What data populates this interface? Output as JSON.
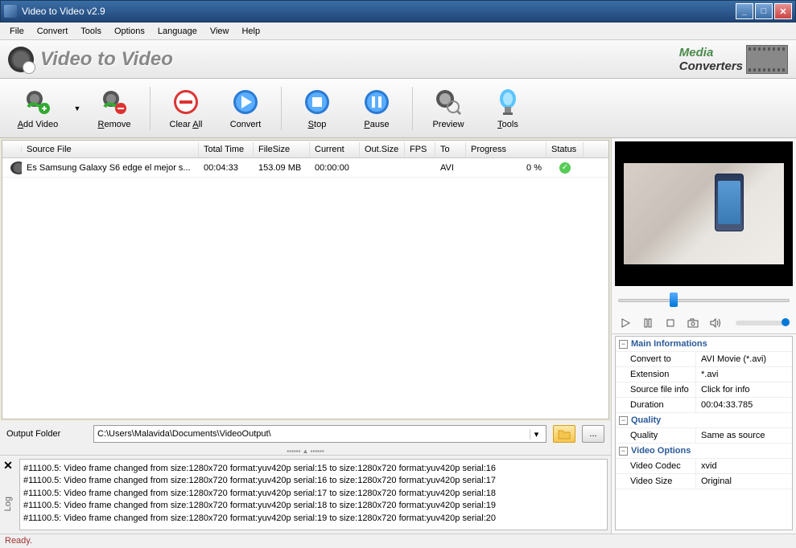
{
  "window": {
    "title": "Video to Video v2.9"
  },
  "menu": [
    "File",
    "Convert",
    "Tools",
    "Options",
    "Language",
    "View",
    "Help"
  ],
  "banner": {
    "title": "Video to Video",
    "brand1": "Media",
    "brand2": "Converters"
  },
  "toolbar": {
    "add": "Add Video",
    "remove": "Remove",
    "clear": "Clear All",
    "convert": "Convert",
    "stop": "Stop",
    "pause": "Pause",
    "preview": "Preview",
    "tools": "Tools"
  },
  "columns": {
    "source": "Source File",
    "time": "Total Time",
    "size": "FileSize",
    "current": "Current",
    "outsize": "Out.Size",
    "fps": "FPS",
    "to": "To",
    "progress": "Progress",
    "status": "Status"
  },
  "rows": [
    {
      "source": "Es Samsung Galaxy S6 edge el mejor s...",
      "time": "00:04:33",
      "size": "153.09 MB",
      "current": "00:00:00",
      "outsize": "",
      "fps": "",
      "to": "AVI",
      "progress": "0 %",
      "status": "ok"
    }
  ],
  "output": {
    "label": "Output Folder",
    "path": "C:\\Users\\Malavida\\Documents\\VideoOutput\\"
  },
  "log": {
    "label": "Log",
    "lines": [
      "#11100.5: Video frame changed from size:1280x720 format:yuv420p serial:15 to size:1280x720 format:yuv420p serial:16",
      "#11100.5: Video frame changed from size:1280x720 format:yuv420p serial:16 to size:1280x720 format:yuv420p serial:17",
      "#11100.5: Video frame changed from size:1280x720 format:yuv420p serial:17 to size:1280x720 format:yuv420p serial:18",
      "#11100.5: Video frame changed from size:1280x720 format:yuv420p serial:18 to size:1280x720 format:yuv420p serial:19",
      "#11100.5: Video frame changed from size:1280x720 format:yuv420p serial:19 to size:1280x720 format:yuv420p serial:20"
    ]
  },
  "props": {
    "main": {
      "title": "Main Informations",
      "rows": [
        {
          "k": "Convert to",
          "v": "AVI Movie (*.avi)"
        },
        {
          "k": "Extension",
          "v": "*.avi"
        },
        {
          "k": "Source file info",
          "v": "Click for info"
        },
        {
          "k": "Duration",
          "v": "00:04:33.785"
        }
      ]
    },
    "quality": {
      "title": "Quality",
      "rows": [
        {
          "k": "Quality",
          "v": "Same as source"
        }
      ]
    },
    "video": {
      "title": "Video Options",
      "rows": [
        {
          "k": "Video Codec",
          "v": "xvid"
        },
        {
          "k": "Video Size",
          "v": "Original"
        }
      ]
    }
  },
  "status": "Ready."
}
